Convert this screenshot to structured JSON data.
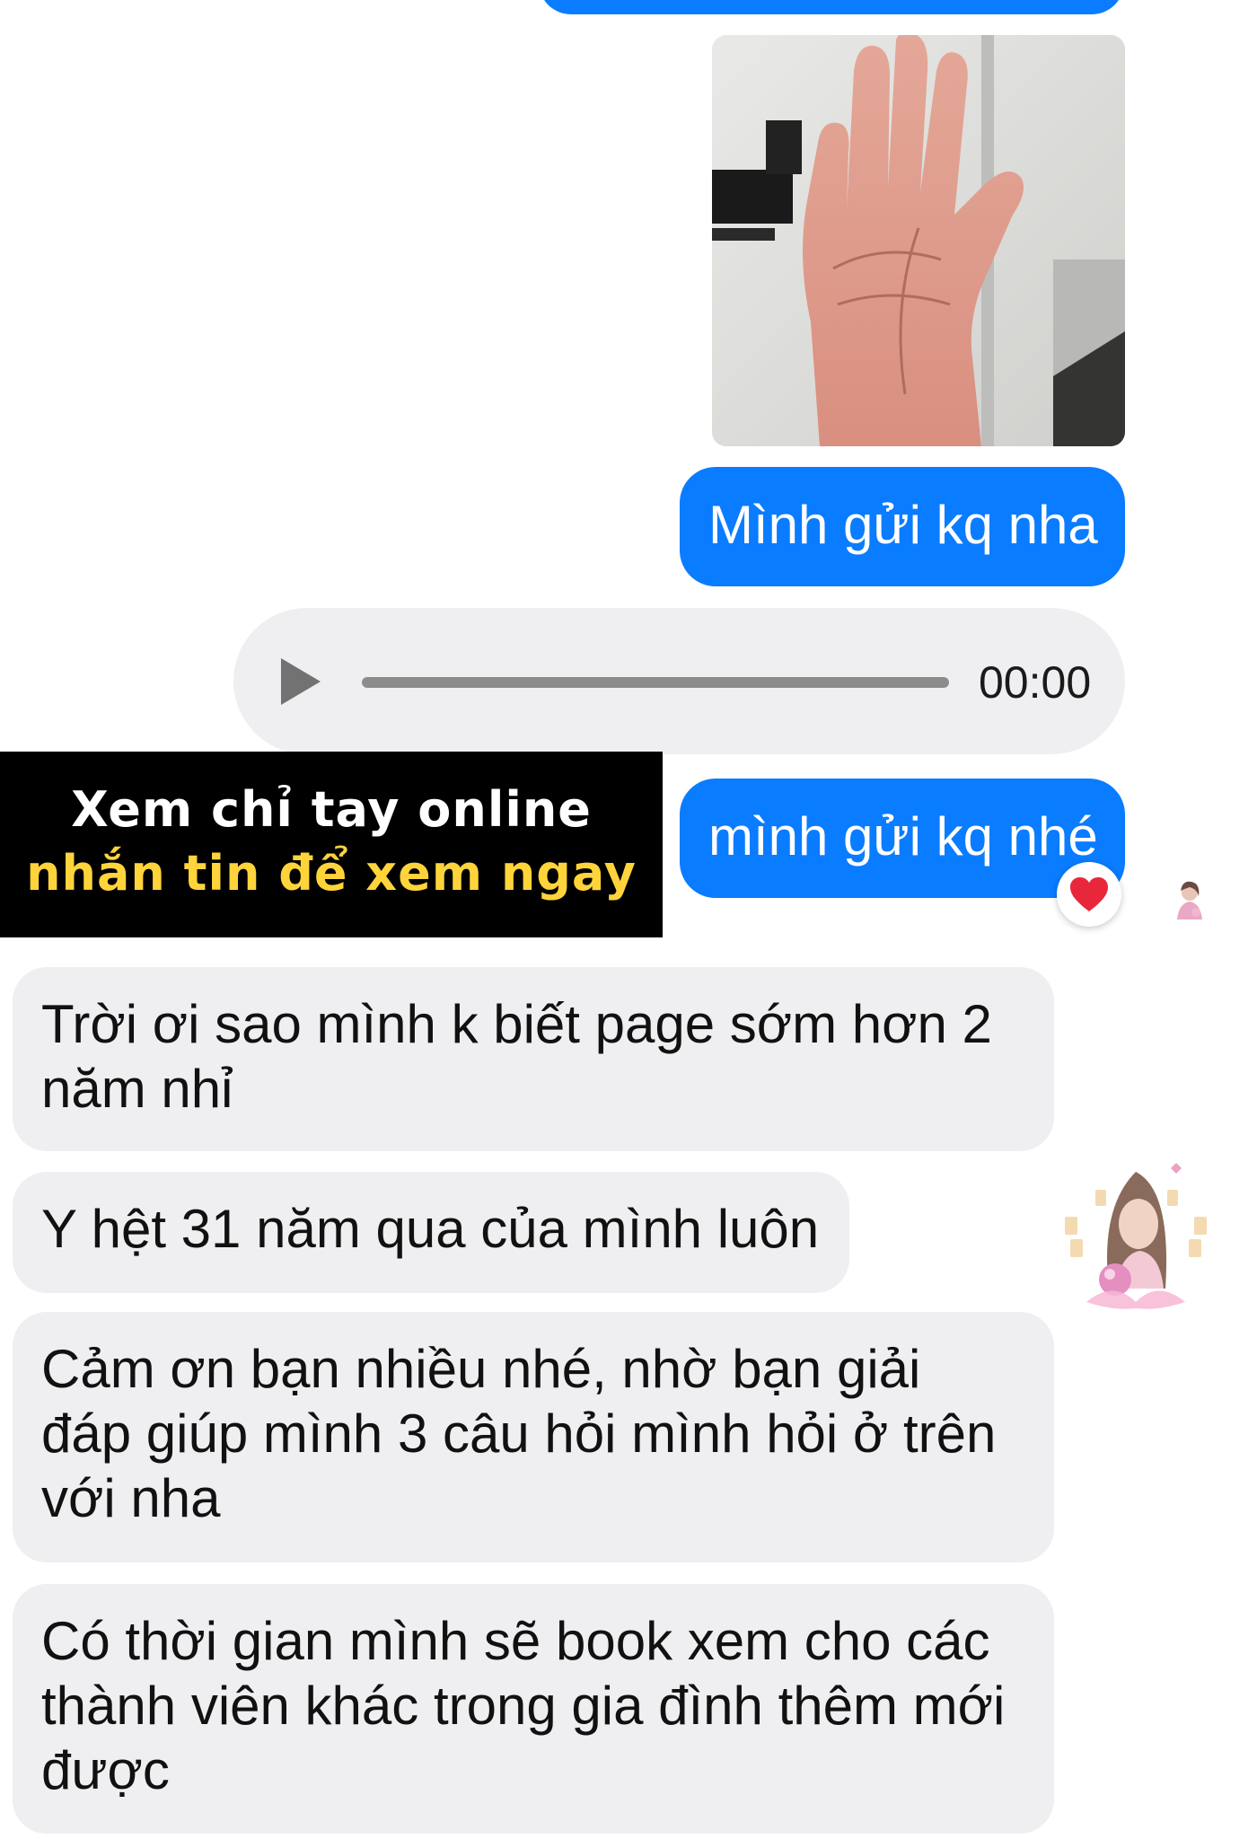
{
  "messages": {
    "outgoing_1": "Mình gửi kq nha",
    "outgoing_2": "mình gửi kq nhé",
    "incoming": [
      "Trời ơi sao mình k biết page sớm hơn 2 năm nhỉ",
      "Y hệt 31 năm qua của mình luôn",
      "Cảm ơn bạn nhiều nhé, nhờ bạn giải đáp giúp mình 3 câu hỏi mình hỏi ở trên với nha",
      "Có thời gian mình sẽ book xem cho các thành viên khác trong gia đình thêm mới được"
    ]
  },
  "voice_message": {
    "duration": "00:00",
    "progress": 0
  },
  "promo": {
    "line1": "Xem chỉ tay online",
    "line2": "nhắn tin để xem ngay"
  },
  "reaction": {
    "icon": "heart-icon",
    "color": "#e8283a"
  },
  "colors": {
    "outgoing_bubble": "#0a7cff",
    "incoming_bubble": "#efeff1",
    "promo_background": "#000000",
    "promo_highlight": "#ffd43b"
  }
}
